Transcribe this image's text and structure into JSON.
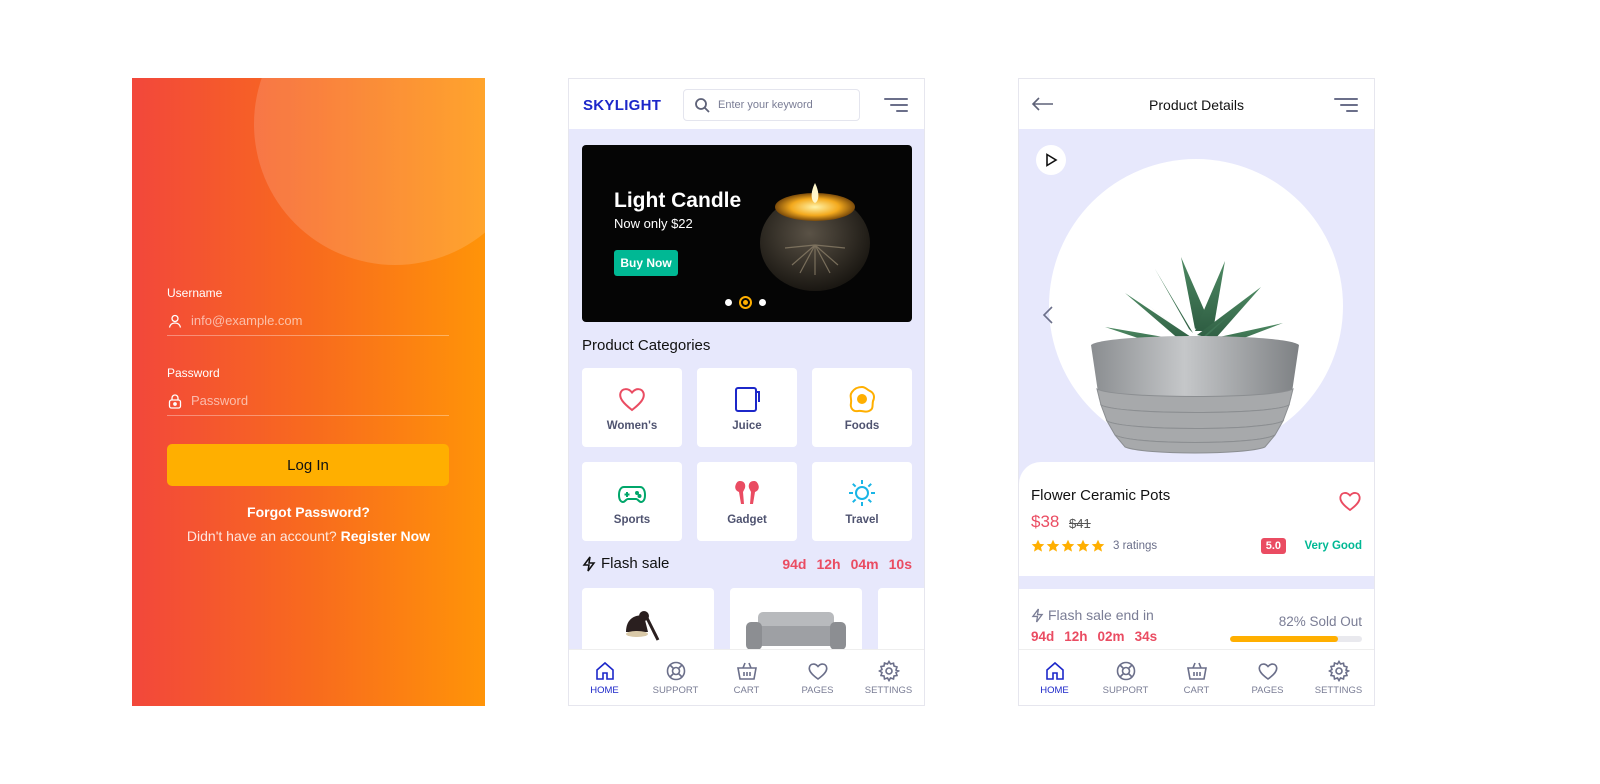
{
  "login": {
    "username_label": "Username",
    "username_placeholder": "info@example.com",
    "password_label": "Password",
    "password_placeholder": "Password",
    "login_button": "Log In",
    "forgot_password": "Forgot Password?",
    "no_account_text": "Didn't have an account?",
    "register_link": "Register Now"
  },
  "home": {
    "brand": "SKYLIGHT",
    "search_placeholder": "Enter your keyword",
    "hero": {
      "title": "Light Candle",
      "subtitle": "Now only $22",
      "button": "Buy Now",
      "slide_count": 3,
      "active_slide": 2
    },
    "categories_title": "Product Categories",
    "categories": [
      {
        "label": "Women's",
        "icon": "heart-icon",
        "color": "#ea4c62"
      },
      {
        "label": "Juice",
        "icon": "cup-icon",
        "color": "#1c27c9"
      },
      {
        "label": "Foods",
        "icon": "egg-icon",
        "color": "#ffaf00"
      },
      {
        "label": "Sports",
        "icon": "gamepad-icon",
        "color": "#00a66a"
      },
      {
        "label": "Gadget",
        "icon": "earbuds-icon",
        "color": "#ea4c62"
      },
      {
        "label": "Travel",
        "icon": "sun-icon",
        "color": "#19b5e6"
      }
    ],
    "flash_title": "Flash sale",
    "countdown": [
      "94d",
      "12h",
      "04m",
      "10s"
    ]
  },
  "details": {
    "title": "Product Details",
    "product_name": "Flower Ceramic Pots",
    "price": "$38",
    "old_price": "$41",
    "rating_stars": 5,
    "ratings_text": "3 ratings",
    "score": "5.0",
    "verdict": "Very Good",
    "flash_label": "Flash sale end in",
    "countdown": [
      "94d",
      "12h",
      "02m",
      "34s"
    ],
    "sold_text": "82% Sold Out",
    "sold_fraction": 0.82
  },
  "nav": [
    "HOME",
    "SUPPORT",
    "CART",
    "PAGES",
    "SETTINGS"
  ],
  "colors": {
    "primary": "#1c27c9",
    "accent_red": "#ea4c62",
    "accent_yellow": "#ffaf00",
    "accent_green": "#00b894",
    "background": "#e7e8fc"
  }
}
